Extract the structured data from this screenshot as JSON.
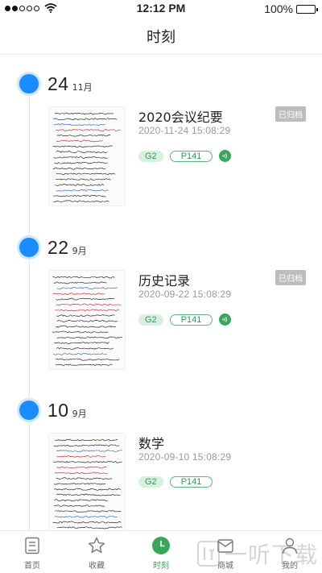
{
  "status_bar": {
    "time": "12:12 PM",
    "battery": "100%"
  },
  "header": {
    "title": "时刻"
  },
  "groups": [
    {
      "day": "24",
      "month": "11月",
      "note": {
        "title": "2020会议纪要",
        "timestamp": "2020-11-24  15:08:29",
        "badge": "已归档",
        "pen": "G2",
        "page": "P141",
        "has_audio": true
      }
    },
    {
      "day": "22",
      "month": "9月",
      "note": {
        "title": "历史记录",
        "timestamp": "2020-09-22  15:08:29",
        "badge": "已归档",
        "pen": "G2",
        "page": "P141",
        "has_audio": true
      }
    },
    {
      "day": "10",
      "month": "9月",
      "note": {
        "title": "数学",
        "timestamp": "2020-09-10  15:08:29",
        "pen": "G2",
        "page": "P141",
        "has_audio": false
      }
    }
  ],
  "tabs": [
    {
      "label": "首页",
      "icon": "home-icon"
    },
    {
      "label": "收藏",
      "icon": "star-icon"
    },
    {
      "label": "时刻",
      "icon": "clock-icon",
      "active": true
    },
    {
      "label": "商城",
      "icon": "mail-icon"
    },
    {
      "label": "我的",
      "icon": "user-icon"
    }
  ],
  "watermark": {
    "text": "一听下载"
  },
  "colors": {
    "accent_blue": "#1a8cff",
    "accent_green": "#3aa65c",
    "badge_gray": "#bdbdbd"
  }
}
